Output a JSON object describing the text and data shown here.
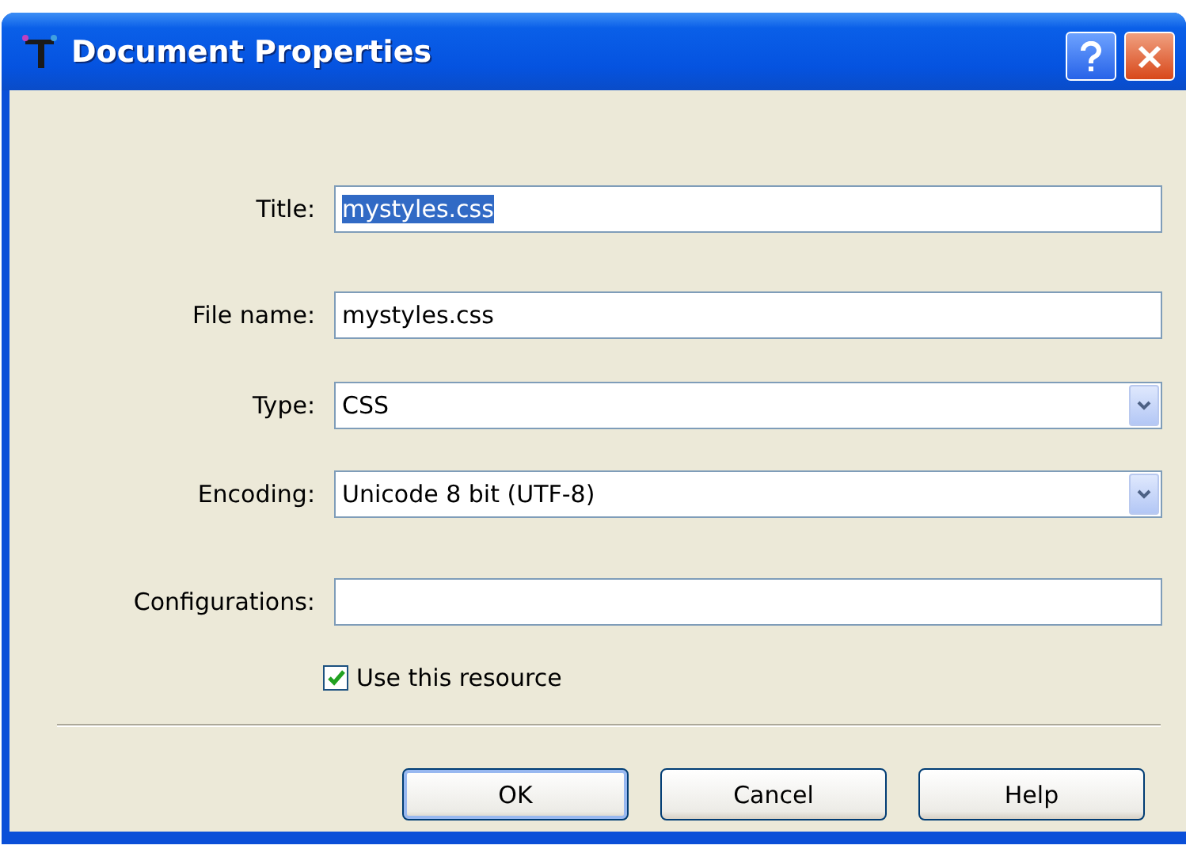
{
  "window": {
    "title": "Document Properties"
  },
  "fields": [
    {
      "kind": "text",
      "label": "Title:",
      "value": "mystyles.css",
      "text_selected": true
    },
    {
      "kind": "text",
      "label": "File name:",
      "value": "mystyles.css"
    },
    {
      "kind": "dropdown",
      "label": "Type:",
      "value": "CSS"
    },
    {
      "kind": "dropdown",
      "label": "Encoding:",
      "value": "Unicode 8 bit (UTF-8)"
    },
    {
      "kind": "text",
      "label": "Configurations:"
    }
  ],
  "checkbox": {
    "label": "Use this resource",
    "checked": true
  },
  "buttons": [
    {
      "label": "OK",
      "default": true
    },
    {
      "label": "Cancel",
      "default": false
    },
    {
      "label": "Help",
      "default": false
    }
  ]
}
